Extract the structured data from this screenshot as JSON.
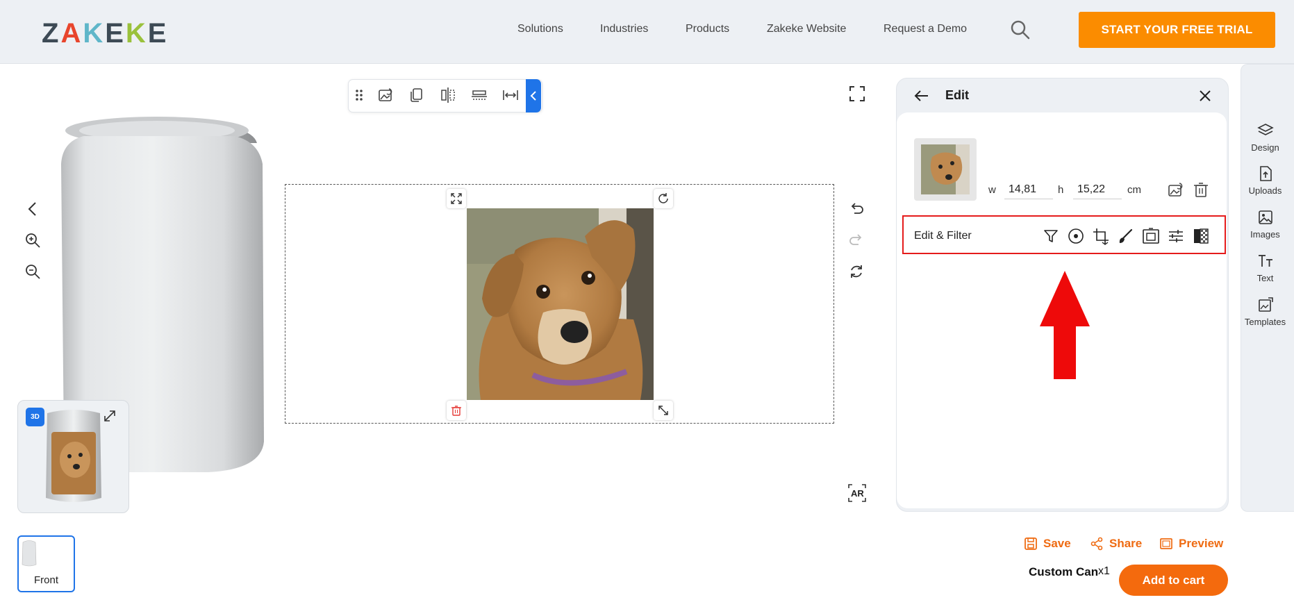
{
  "header": {
    "logo": "ZAKEKE",
    "nav": [
      "Solutions",
      "Industries",
      "Products",
      "Zakeke Website",
      "Request a Demo"
    ],
    "cta_label": "START YOUR FREE TRIAL"
  },
  "toolbar": {
    "icons": [
      "drag-handle-icon",
      "replace-image-icon",
      "duplicate-icon",
      "flip-horizontal-icon",
      "align-center-icon",
      "fit-width-icon",
      "collapse-chevron-icon"
    ]
  },
  "viewer": {
    "mini_badge": "3D",
    "ar_label": "AR"
  },
  "edit_panel": {
    "title": "Edit",
    "width_label": "w",
    "width_value": "14,81",
    "height_label": "h",
    "height_value": "15,22",
    "unit": "cm",
    "filter_label": "Edit & Filter",
    "filter_tools": [
      "filter-icon",
      "circle-crop-icon",
      "crop-icon",
      "brush-icon",
      "frame-icon",
      "adjust-icon",
      "transparency-icon"
    ]
  },
  "side_nav": [
    {
      "label": "Design",
      "icon": "layers-icon"
    },
    {
      "label": "Uploads",
      "icon": "upload-file-icon"
    },
    {
      "label": "Images",
      "icon": "image-icon"
    },
    {
      "label": "Text",
      "icon": "text-icon"
    },
    {
      "label": "Templates",
      "icon": "templates-icon"
    }
  ],
  "views": {
    "front_label": "Front"
  },
  "actions": {
    "save": "Save",
    "share": "Share",
    "preview": "Preview",
    "product_name": "Custom Can",
    "quantity": "x1",
    "add_to_cart": "Add to cart"
  },
  "colors": {
    "accent_orange": "#fb8c00",
    "primary_blue": "#1f74e8",
    "highlight_red": "#e51b1b"
  }
}
